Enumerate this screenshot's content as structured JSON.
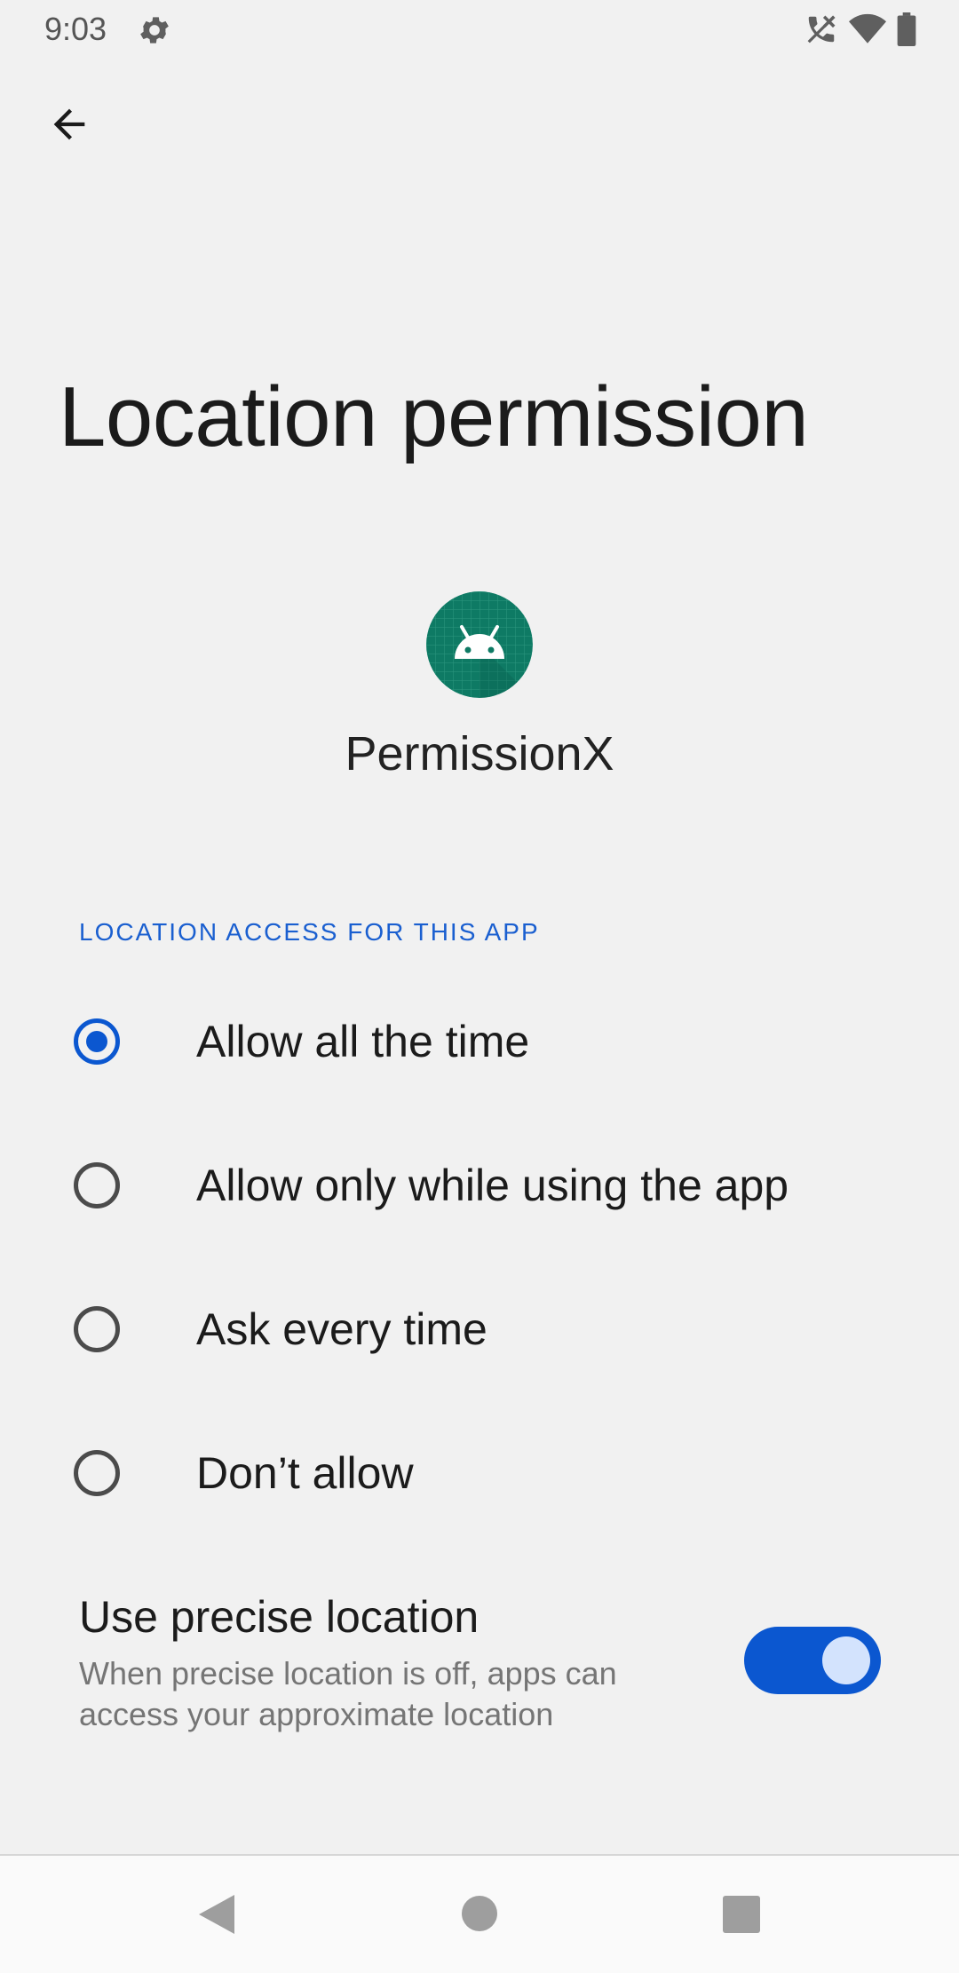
{
  "status_bar": {
    "time": "9:03",
    "icons": [
      "settings-gear-icon",
      "no-call-icon",
      "wifi-icon",
      "battery-icon"
    ]
  },
  "header": {
    "back_icon": "arrow-back-icon",
    "title": "Location permission"
  },
  "app": {
    "icon": "android-app-icon",
    "name": "PermissionX"
  },
  "section": {
    "header": "LOCATION ACCESS FOR THIS APP"
  },
  "options": [
    {
      "label": "Allow all the time",
      "selected": true
    },
    {
      "label": "Allow only while using the app",
      "selected": false
    },
    {
      "label": "Ask every time",
      "selected": false
    },
    {
      "label": "Don’t allow",
      "selected": false
    }
  ],
  "precise": {
    "title": "Use precise location",
    "description": "When precise location is off, apps can access your approximate location",
    "enabled": true
  },
  "colors": {
    "accent": "#0b57d0",
    "toggle_thumb": "#d3e3fd",
    "background": "#f1f1f1",
    "app_icon_bg": "#0e7a64"
  },
  "nav_bar": {
    "icons": [
      "nav-back-icon",
      "nav-home-icon",
      "nav-recents-icon"
    ]
  }
}
